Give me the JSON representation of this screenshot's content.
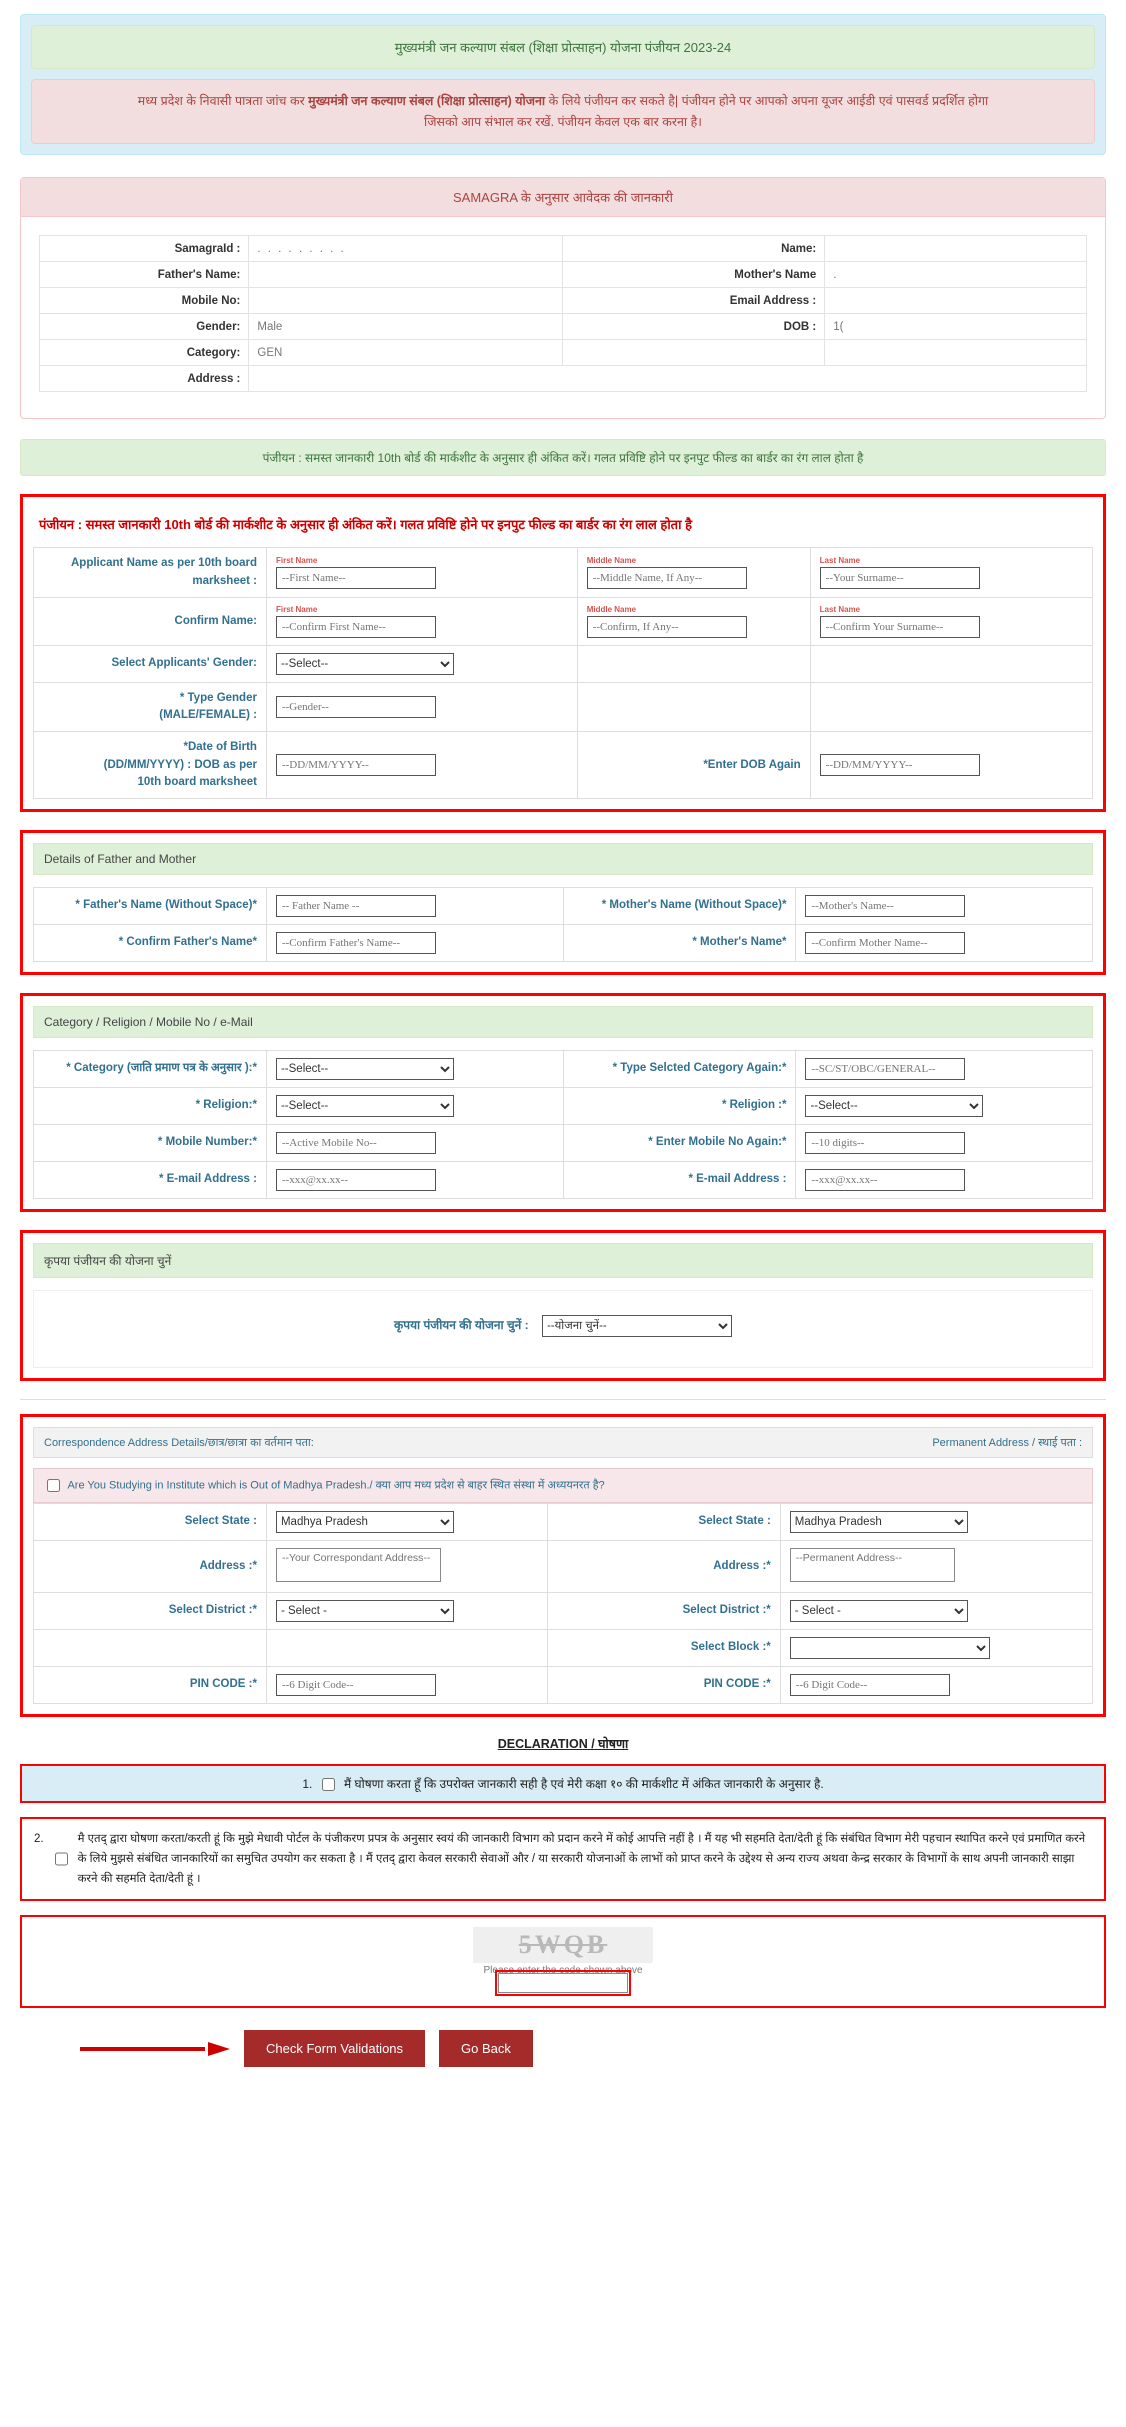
{
  "header": {
    "title": "मुख्यमंत्री जन कल्याण संबल (शिक्षा प्रोत्साहन) योजना  पंजीयन  2023-24",
    "notice_line1_a": "मध्य प्रदेश के निवासी पात्रता जांच कर ",
    "notice_bold": "मुख्यमंत्री जन कल्याण संबल (शिक्षा प्रोत्साहन) योजना",
    "notice_line1_b": " के लिये पंजीयन कर सकते है| पंजीयन होने पर आपको अपना यूजर आईडी एवं पासवर्ड प्रदर्शित होगा",
    "notice_line2": "जिसको आप संभाल कर रखें. पंजीयन केवल एक बार करना है।"
  },
  "samagra": {
    "panel_title": "SAMAGRA के अनुसार आवेदक की जानकारी",
    "rows": [
      {
        "l1": "SamagraId :",
        "v1": ". . . . . . . . .",
        "l2": "Name:",
        "v2": ""
      },
      {
        "l1": "Father's Name:",
        "v1": "",
        "l2": "Mother's Name",
        "v2": "."
      },
      {
        "l1": "Mobile No:",
        "v1": "",
        "l2": "Email Address :",
        "v2": ""
      },
      {
        "l1": "Gender:",
        "v1": "Male",
        "l2": "DOB :",
        "v2": "1("
      },
      {
        "l1": "Category:",
        "v1": "GEN",
        "l2": "",
        "v2": ""
      },
      {
        "l1": "Address :",
        "v1": "",
        "l2": "",
        "v2": ""
      }
    ]
  },
  "green_bar": "पंजीयन : समस्त जानकारी 10th बोर्ड की मार्कशीट के अनुसार ही अंकित करें। गलत प्रविष्टि होने पर इनपुट फील्ड का बार्डर का रंग लाल होता है",
  "applicant": {
    "heading": "पंजीयन : समस्त जानकारी 10th बोर्ड की मार्कशीट के अनुसार ही अंकित करें। गलत प्रविष्टि होने पर इनपुट फील्ड का बार्डर का रंग लाल होता है",
    "name_label": "Applicant Name  as per 10th board marksheet  :",
    "confirm_label": "Confirm Name:",
    "gender_label": "Select Applicants' Gender:",
    "type_gender_label_1": "* Type Gender",
    "type_gender_label_2": "(MALE/FEMALE) :",
    "dob_label_1": "*Date of Birth",
    "dob_label_2": "(DD/MM/YYYY) : DOB as per",
    "dob_label_3": "10th board marksheet",
    "dob_again_label": "*Enter DOB Again",
    "mini_first": "First Name",
    "mini_middle": "Middle Name",
    "mini_last": "Last Name",
    "ph_first": "--First Name--",
    "ph_middle": "--Middle Name, If Any--",
    "ph_last": "--Your Surname--",
    "ph_confirm_first": "--Confirm First Name--",
    "ph_confirm_middle": "--Confirm, If Any--",
    "ph_confirm_last": "--Confirm Your Surname--",
    "gender_selected": "--Select--",
    "ph_type_gender": "--Gender--",
    "ph_dob": "--DD/MM/YYYY--",
    "ph_dob_again": "--DD/MM/YYYY--"
  },
  "parents": {
    "section_title": "Details of Father and Mother",
    "father_label": "* Father's Name (Without Space)*",
    "mother_label": "* Mother's Name (Without Space)*",
    "confirm_father_label": "* Confirm Father's Name*",
    "confirm_mother_label": "* Mother's Name*",
    "ph_father": "-- Father Name --",
    "ph_mother": "--Mother's Name--",
    "ph_confirm_father": "--Confirm Father's Name--",
    "ph_confirm_mother": "--Confirm Mother Name--"
  },
  "category": {
    "section_title": "Category / Religion / Mobile No / e-Mail",
    "cat_label": "* Category (जाति प्रमाण पत्र के अनुसार ):*",
    "cat_again_label": "* Type Selcted Category Again:*",
    "religion_label": "* Religion:*",
    "religion2_label": "* Religion :*",
    "mobile_label": "* Mobile Number:*",
    "mobile_again_label": "* Enter Mobile No Again:*",
    "email_label": "* E-mail Address :",
    "email2_label": "* E-mail Address :",
    "cat_selected": "--Select--",
    "ph_cat_again": "--SC/ST/OBC/GENERAL--",
    "religion_selected": "--Select--",
    "religion2_selected": "--Select--",
    "ph_mobile": "--Active Mobile No--",
    "ph_mobile_again": "--10 digits--",
    "ph_email": "--xxx@xx.xx--",
    "ph_email2": "--xxx@xx.xx--"
  },
  "yojana": {
    "section_title": "कृपया पंजीयन की योजना चुनें",
    "label": "कृपया पंजीयन की योजना चुनें :",
    "selected": "--योजना चुनें--"
  },
  "address": {
    "head_left": "Correspondence Address Details/छात्र/छात्रा का वर्तमान पता:",
    "head_right": "Permanent Address / स्थाई पता :",
    "study_question": "Are You Studying in Institute which is Out of Madhya Pradesh./ क्या आप मध्य प्रदेश से बाहर स्थित संस्था में अध्ययनरत है?",
    "state_label": "Select State :",
    "state_value": "Madhya Pradesh",
    "state_label_r": "Select State :",
    "state_value_r": "Madhya Pradesh",
    "addr_label": "Address :*",
    "addr_label_r": "Address :*",
    "ph_addr": "--Your Correspondant Address--",
    "ph_addr_r": "--Permanent Address--",
    "district_label": "Select District :*",
    "district_value": "- Select -",
    "district_label_r": "Select District :*",
    "district_value_r": "- Select -",
    "block_label": "Select Block :*",
    "block_value": "",
    "pin_label": "PIN CODE :*",
    "pin_label_r": "PIN CODE :*",
    "ph_pin": "--6 Digit Code--",
    "ph_pin_r": "--6 Digit Code--"
  },
  "declaration": {
    "title": "DECLARATION / घोषणा",
    "item1_no": "1.",
    "item1_text": "मैं घोषणा करता हूँ कि उपरोक्त जानकारी सही है एवं मेरी कक्षा १० की मार्कशीट में अंकित जानकारी के अनुसार है.",
    "item2_no": "2.",
    "item2_text": "मै एतद् द्वारा घोषणा करता/करती हूं कि मुझे मेधावी पोर्टल के पंजीकरण प्रपत्र के अनुसार स्वयं की जानकारी विभाग को प्रदान करने में कोई आपत्ति नहीं है । मैं यह भी सहमति देता/देती हूं कि संबंधित विभाग मेरी पहचान स्थापित करने एवं प्रमाणित करने के लिये मुझसे संबंधित जानकारियों का समुचित उपयोग कर सकता है । मैं एतद् द्वारा केवल सरकारी सेवाओं और / या सरकारी योजनाओं के लाभों को प्राप्त करने के उद्देश्य से अन्य राज्य अथवा केन्द्र सरकार के विभागों के साथ अपनी जानकारी साझा करने की सहमति देता/देती हूं ।"
  },
  "captcha": {
    "code": "5WQB",
    "hint": "Please enter the code shown above",
    "input_value": ""
  },
  "buttons": {
    "submit": "Check Form Validations",
    "back": "Go Back"
  }
}
